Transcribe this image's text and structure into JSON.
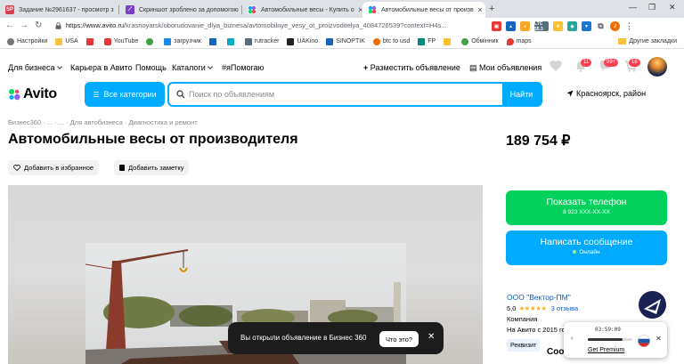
{
  "browser": {
    "tabs": [
      {
        "title": "Задание №2961637 - просмотр з",
        "icon_text": "SP",
        "icon_color": "#d93b50",
        "active": false
      },
      {
        "title": "Скриншот зроблено за допомогою",
        "icon_text": "",
        "icon_color": "#7b3fc4",
        "active": false
      },
      {
        "title": "Автомобильные весы - Купить о",
        "icon_text": "",
        "icon_color": "#00aaff",
        "active": false
      },
      {
        "title": "Автомобильные весы от произв",
        "icon_text": "",
        "icon_color": "#00aaff",
        "active": true
      }
    ],
    "url_host": "https://www.avito.ru",
    "url_path": "/krasnoyarsk/oborudovanie_dlya_biznesa/avtomobilnye_vesy_ot_proizvoditelya_4084726539?context=H4s...",
    "extensions": [
      {
        "label": "",
        "color": "#e53935"
      },
      {
        "label": "",
        "color": "#1565c0"
      },
      {
        "label": "",
        "color": "#f9a825"
      },
      {
        "label": "LTC 55.3",
        "color": "#546e7a"
      },
      {
        "label": "",
        "color": "#fbc02d"
      },
      {
        "label": "",
        "color": "#26a69a"
      },
      {
        "label": "",
        "color": "#1976d2"
      },
      {
        "label": "",
        "color": "#9e9e9e"
      },
      {
        "label": "",
        "color": "#ef6c00"
      },
      {
        "label": "",
        "color": "#6d4c41"
      }
    ],
    "bookmarks": [
      {
        "label": "Настройки",
        "color": "#757575"
      },
      {
        "label": "USA",
        "color": "#1e88e5"
      },
      {
        "label": "",
        "color": "#e53935"
      },
      {
        "label": "YouTube",
        "color": "#e53935"
      },
      {
        "label": "",
        "color": "#43a047"
      },
      {
        "label": "загрузчик",
        "color": "#1e88e5"
      },
      {
        "label": "",
        "color": "#1565c0"
      },
      {
        "label": "",
        "color": "#00acc1"
      },
      {
        "label": "rutracker",
        "color": "#546e7a"
      },
      {
        "label": "UAKino",
        "color": "#212121"
      },
      {
        "label": "SINOPTIK",
        "color": "#1565c0"
      },
      {
        "label": "btc to usd",
        "color": "#ef6c00"
      },
      {
        "label": "FP",
        "color": "#00897b"
      },
      {
        "label": "",
        "color": "#fbc02d"
      },
      {
        "label": "Обмінник",
        "color": "#43a047"
      },
      {
        "label": "maps",
        "color": "#e53935"
      }
    ],
    "bookmarks_other": "Другие закладки"
  },
  "header": {
    "links": [
      "Для бизнеса",
      "Карьера в Авито",
      "Помощь",
      "Каталоги",
      "#яПомогаю"
    ],
    "post_ad": "Разместить объявление",
    "my_ads": "Мои объявления",
    "badges": {
      "notifications": "11",
      "messages": "99+",
      "cart": "16"
    }
  },
  "searchbar": {
    "logo": "Avito",
    "categories": "Все категории",
    "placeholder": "Поиск по объявлениям",
    "search_button": "Найти",
    "location": "Красноярск, район"
  },
  "listing": {
    "breadcrumb": "Бизнес360  ·  ...  ·  ...  ·  Для автобизнеса  ·  Диагностика и ремонт",
    "title": "Автомобильные весы от производителя",
    "price": "189 754 ₽",
    "favorite": "Добавить в избранное",
    "note": "Добавить заметку"
  },
  "contact": {
    "phone_label": "Показать телефон",
    "phone_masked": "8 923 XXX-XX-XX",
    "message_label": "Написать сообщение",
    "online": "Онлайн"
  },
  "seller": {
    "name": "ООО \"Вектор-ПМ\"",
    "rating": "5,0",
    "stars": "★★★★★",
    "reviews": "3 отзыва",
    "type": "Компания",
    "since": "На Авито с 2015 го",
    "requisites": "Реквизит",
    "truncated_text": "Соо"
  },
  "toast": {
    "text": "Вы открыли объявление в Бизнес 360",
    "button": "Что это?"
  },
  "widget": {
    "time": "03:59:09",
    "progress": 0.78,
    "link": "Get Premium"
  },
  "colors": {
    "avito_blue": "#00aaff",
    "avito_green": "#02d15c",
    "badge_red": "#ff4053",
    "link_blue": "#0a5dc4"
  }
}
